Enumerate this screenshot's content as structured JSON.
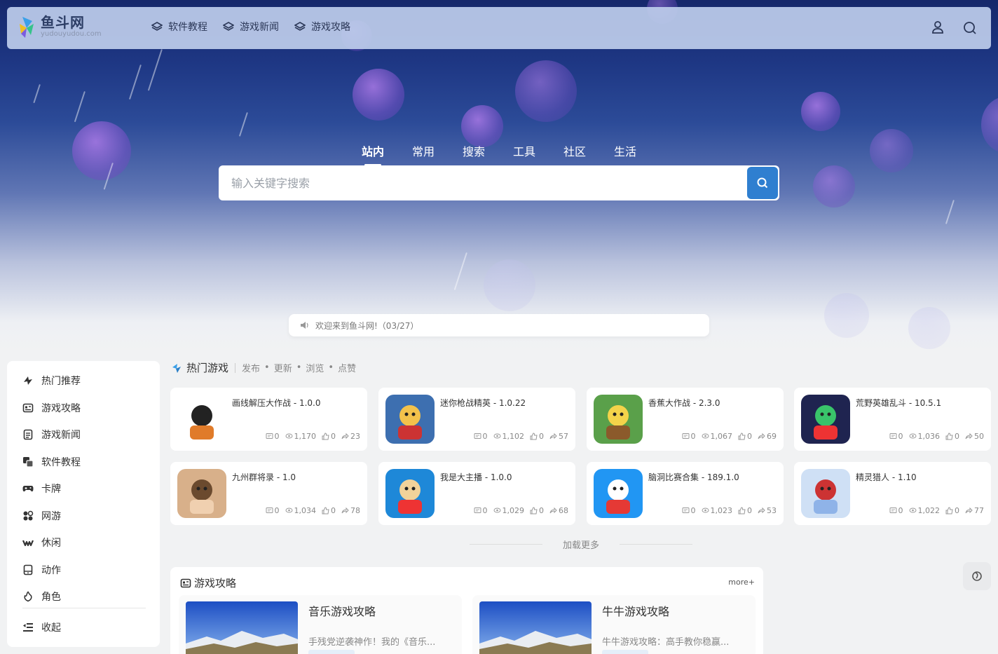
{
  "site": {
    "name": "鱼斗网",
    "domain_text": "yudouyudou.com"
  },
  "header": {
    "nav": [
      {
        "label": "软件教程",
        "icon": "layers-icon"
      },
      {
        "label": "游戏新闻",
        "icon": "layers-icon"
      },
      {
        "label": "游戏攻略",
        "icon": "layers-icon"
      }
    ],
    "user_icon": "user-icon",
    "search_icon": "search-icon"
  },
  "search": {
    "tabs": [
      "站内",
      "常用",
      "搜索",
      "工具",
      "社区",
      "生活"
    ],
    "active_tab": "站内",
    "placeholder": "输入关键字搜索"
  },
  "notice": {
    "text": "欢迎来到鱼斗网!（03/27）"
  },
  "sidebar": {
    "items": [
      {
        "label": "热门推荐",
        "icon": "hot-icon"
      },
      {
        "label": "游戏攻略",
        "icon": "guide-icon"
      },
      {
        "label": "游戏新闻",
        "icon": "news-icon"
      },
      {
        "label": "软件教程",
        "icon": "software-icon"
      },
      {
        "label": "卡牌",
        "icon": "gamepad-icon"
      },
      {
        "label": "网游",
        "icon": "online-icon"
      },
      {
        "label": "休闲",
        "icon": "casual-icon"
      },
      {
        "label": "动作",
        "icon": "action-icon"
      },
      {
        "label": "角色",
        "icon": "role-icon"
      }
    ],
    "collapse_label": "收起"
  },
  "hot_games": {
    "title": "热门游戏",
    "filters": [
      "发布",
      "更新",
      "浏览",
      "点赞"
    ],
    "cards": [
      {
        "name": "画线解压大作战 - 1.0.0",
        "comments": "0",
        "views": "1,170",
        "likes": "0",
        "shares": "23"
      },
      {
        "name": "迷你枪战精英 - 1.0.22",
        "comments": "0",
        "views": "1,102",
        "likes": "0",
        "shares": "57"
      },
      {
        "name": "香蕉大作战 - 2.3.0",
        "comments": "0",
        "views": "1,067",
        "likes": "0",
        "shares": "69"
      },
      {
        "name": "荒野英雄乱斗 - 10.5.1",
        "comments": "0",
        "views": "1,036",
        "likes": "0",
        "shares": "50"
      },
      {
        "name": "九州群将录 - 1.0",
        "comments": "0",
        "views": "1,034",
        "likes": "0",
        "shares": "78"
      },
      {
        "name": "我是大主播 - 1.0.0",
        "comments": "0",
        "views": "1,029",
        "likes": "0",
        "shares": "68"
      },
      {
        "name": "脑洞比赛合集 - 189.1.0",
        "comments": "0",
        "views": "1,023",
        "likes": "0",
        "shares": "53"
      },
      {
        "name": "精灵猎人 - 1.10",
        "comments": "0",
        "views": "1,022",
        "likes": "0",
        "shares": "77"
      }
    ],
    "load_more": "加载更多"
  },
  "guide": {
    "title": "游戏攻略",
    "more": "more+",
    "posts": [
      {
        "title": "音乐游戏攻略",
        "desc": "手残党逆袭神作！我的《音乐..."
      },
      {
        "title": "牛牛游戏攻略",
        "desc": "牛牛游戏攻略：高手教你稳赢..."
      }
    ]
  },
  "colors": {
    "accent": "#2f7fd0",
    "header_bg": "#becdeb",
    "hero_top": "#16286b"
  }
}
